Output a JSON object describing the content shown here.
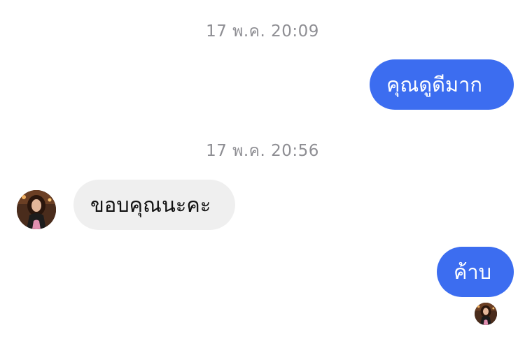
{
  "thread": {
    "messages": [
      {
        "type": "timestamp",
        "text": "17 พ.ค. 20:09"
      },
      {
        "type": "outgoing",
        "text": "คุณดูดีมาก"
      },
      {
        "type": "timestamp",
        "text": "17 พ.ค. 20:56"
      },
      {
        "type": "incoming",
        "text": "ขอบคุณนะคะ",
        "sender_avatar": "profile-avatar"
      },
      {
        "type": "outgoing",
        "text": "ค้าบ",
        "read_receipt": "profile-avatar"
      }
    ]
  },
  "colors": {
    "outgoing_bubble": "#3c6df0",
    "incoming_bubble": "#efefef",
    "timestamp_text": "#8e8e93",
    "background": "#ffffff"
  }
}
